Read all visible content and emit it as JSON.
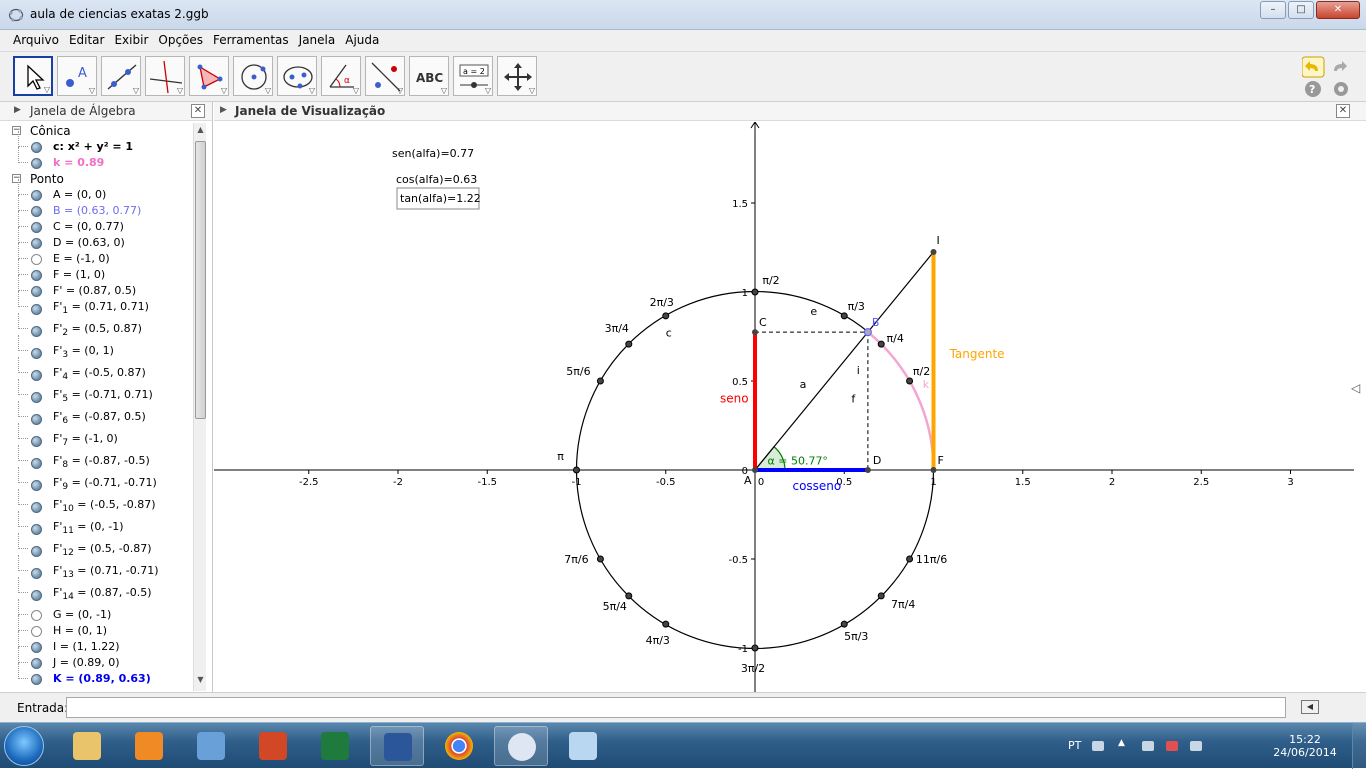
{
  "window": {
    "title": "aula de ciencias exatas 2.ggb",
    "minimize": "–",
    "maximize": "□",
    "close": "✕"
  },
  "menu": [
    "Arquivo",
    "Editar",
    "Exibir",
    "Opções",
    "Ferramentas",
    "Janela",
    "Ajuda"
  ],
  "toolbar": {
    "tools": [
      "move-tool",
      "point-tool",
      "line-tool",
      "perpendicular-tool",
      "polygon-tool",
      "circle-center-tool",
      "conic-tool",
      "angle-tool",
      "reflect-tool",
      "text-tool",
      "slider-tool",
      "move-view-tool"
    ],
    "text_tool_label": "ABC",
    "slider_tool_label": "a = 2"
  },
  "algebra": {
    "header": "Janela de Álgebra",
    "groups": [
      {
        "name": "Cônica",
        "items": [
          {
            "text": "c: x² + y² = 1",
            "style": "bold"
          },
          {
            "text": "k = 0.89",
            "style": "pink"
          }
        ]
      },
      {
        "name": "Ponto",
        "items": [
          {
            "text": "A = (0, 0)",
            "style": ""
          },
          {
            "text": "B = (0.63, 0.77)",
            "style": "purple"
          },
          {
            "text": "C = (0, 0.77)",
            "style": ""
          },
          {
            "text": "D = (0.63, 0)",
            "style": ""
          },
          {
            "text": "E = (-1, 0)",
            "style": "",
            "hollow": true
          },
          {
            "text": "F = (1, 0)",
            "style": ""
          },
          {
            "text": "F' = (0.87, 0.5)",
            "style": ""
          },
          {
            "text": "F'",
            "sub": "1",
            "rest": " = (0.71, 0.71)",
            "style": ""
          },
          {
            "text": "F'",
            "sub": "2",
            "rest": " = (0.5, 0.87)",
            "style": ""
          },
          {
            "text": "F'",
            "sub": "3",
            "rest": " = (0, 1)",
            "style": ""
          },
          {
            "text": "F'",
            "sub": "4",
            "rest": " = (-0.5, 0.87)",
            "style": ""
          },
          {
            "text": "F'",
            "sub": "5",
            "rest": " = (-0.71, 0.71)",
            "style": ""
          },
          {
            "text": "F'",
            "sub": "6",
            "rest": " = (-0.87, 0.5)",
            "style": ""
          },
          {
            "text": "F'",
            "sub": "7",
            "rest": " = (-1, 0)",
            "style": ""
          },
          {
            "text": "F'",
            "sub": "8",
            "rest": " = (-0.87, -0.5)",
            "style": ""
          },
          {
            "text": "F'",
            "sub": "9",
            "rest": " = (-0.71, -0.71)",
            "style": ""
          },
          {
            "text": "F'",
            "sub": "10",
            "rest": " = (-0.5, -0.87)",
            "style": ""
          },
          {
            "text": "F'",
            "sub": "11",
            "rest": " = (0, -1)",
            "style": ""
          },
          {
            "text": "F'",
            "sub": "12",
            "rest": " = (0.5, -0.87)",
            "style": ""
          },
          {
            "text": "F'",
            "sub": "13",
            "rest": " = (0.71, -0.71)",
            "style": ""
          },
          {
            "text": "F'",
            "sub": "14",
            "rest": " = (0.87, -0.5)",
            "style": ""
          },
          {
            "text": "G = (0, -1)",
            "style": "",
            "hollow": true
          },
          {
            "text": "H = (0, 1)",
            "style": "",
            "hollow": true
          },
          {
            "text": "I = (1, 1.22)",
            "style": ""
          },
          {
            "text": "J = (0.89, 0)",
            "style": ""
          },
          {
            "text": "K = (0.89, 0.63)",
            "style": "blue"
          }
        ]
      }
    ]
  },
  "graphics": {
    "header": "Janela de Visualização",
    "texts": {
      "sen": "sen(alfa)=0.77",
      "cos": "cos(alfa)=0.63",
      "tan": "tan(alfa)=1.22"
    },
    "x_ticks": [
      "-2.5",
      "-2",
      "-1.5",
      "-1",
      "-0.5",
      "0",
      "0.5",
      "1",
      "1.5",
      "2",
      "2.5",
      "3"
    ],
    "x_tick_values": [
      -2.5,
      -2,
      -1.5,
      -1,
      -0.5,
      0,
      0.5,
      1,
      1.5,
      2,
      2.5,
      3
    ],
    "y_ticks": [
      "1.5",
      "1",
      "0.5",
      "0",
      "-0.5",
      "-1"
    ],
    "y_tick_values": [
      1.5,
      1,
      0.5,
      0,
      -0.5,
      -1
    ],
    "angle_labels": [
      {
        "label": "π/2",
        "deg": 90
      },
      {
        "label": "π/3",
        "deg": 60
      },
      {
        "label": "π/4",
        "deg": 45
      },
      {
        "label": "π/2",
        "deg": 30,
        "note": "as shown"
      },
      {
        "label": "2π/3",
        "deg": 120
      },
      {
        "label": "3π/4",
        "deg": 135
      },
      {
        "label": "5π/6",
        "deg": 150
      },
      {
        "label": "π",
        "deg": 180
      },
      {
        "label": "7π/6",
        "deg": 210
      },
      {
        "label": "5π/4",
        "deg": 225
      },
      {
        "label": "4π/3",
        "deg": 240
      },
      {
        "label": "3π/2",
        "deg": 270
      },
      {
        "label": "5π/3",
        "deg": 300
      },
      {
        "label": "7π/4",
        "deg": 315
      },
      {
        "label": "11π/6",
        "deg": 330
      }
    ],
    "point_labels": {
      "A": "A",
      "B": "B",
      "C": "C",
      "D": "D",
      "F": "F",
      "I": "I"
    },
    "segment_labels": {
      "a": "a",
      "c": "c",
      "e": "e",
      "f": "f",
      "i": "i",
      "k": "k"
    },
    "seno": "seno",
    "cosseno": "cosseno",
    "tangente": "Tangente",
    "alpha_label": "α = 50.77°",
    "alpha_deg": 50.77,
    "colors": {
      "seno": "#ff0000",
      "cosseno": "#0000ff",
      "tangente": "#ffa500",
      "arc": "#f4a6d2",
      "angle": "#007f00"
    }
  },
  "input": {
    "label": "Entrada:",
    "value": ""
  },
  "taskbar": {
    "lang": "PT",
    "time": "15:22",
    "date": "24/06/2014"
  }
}
